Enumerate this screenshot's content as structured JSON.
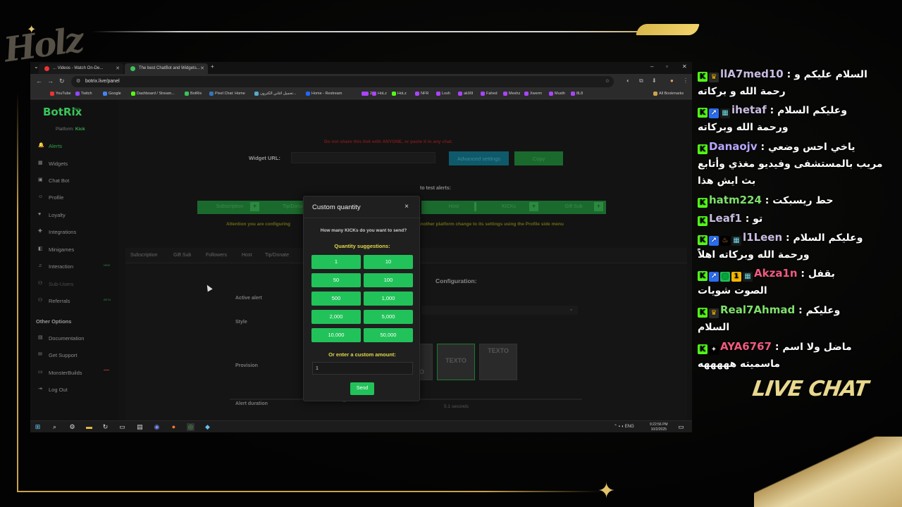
{
  "overlay": {
    "logo_text": "Holz",
    "live_chat_title": "LIVE CHAT",
    "accent_gold": "#c9a24a"
  },
  "browser": {
    "tabs": [
      {
        "label": "... Videos - Watch On-De...",
        "favicon_color": "#e33"
      },
      {
        "label": "The best ChatBot and Widgets...",
        "favicon_color": "#39c45a"
      }
    ],
    "new_tab": "+",
    "url": "botrix.live/panel",
    "bookmarks": [
      {
        "label": "YouTube",
        "color": "#e33"
      },
      {
        "label": "Twitch",
        "color": "#9146ff"
      },
      {
        "label": "Google",
        "color": "#4285f4"
      },
      {
        "label": "Dashboard / Stream...",
        "color": "#53fc18"
      },
      {
        "label": "BotRix",
        "color": "#39c45a"
      },
      {
        "label": "Pixel Chat: Home",
        "color": "#37b"
      },
      {
        "label": "تحميل اغاني الكترون...",
        "color": "#5ac"
      },
      {
        "label": "Home - Restream",
        "color": "#26f"
      },
      {
        "label": "",
        "color": "#a4f"
      },
      {
        "label": "2",
        "color": "#a4f"
      },
      {
        "label": "HoLz",
        "color": "#a4f"
      },
      {
        "label": "HoLz",
        "color": "#53fc18"
      },
      {
        "label": "NFR",
        "color": "#a4f"
      },
      {
        "label": "Losh",
        "color": "#a4f"
      },
      {
        "label": "ak90l",
        "color": "#a4f"
      },
      {
        "label": "Fahed",
        "color": "#a4f"
      },
      {
        "label": "Meshz",
        "color": "#a4f"
      },
      {
        "label": "Xwerm",
        "color": "#a4f"
      },
      {
        "label": "Musth",
        "color": "#a4f"
      },
      {
        "label": "8L8",
        "color": "#a4f"
      }
    ],
    "all_bookmarks": "All Bookmarks"
  },
  "sidebar": {
    "brand": "BotRix",
    "beta": "BETA",
    "platform_label": "Platform:",
    "platform_value": "Kick",
    "items": [
      {
        "label": "Alerts",
        "icon": "bell"
      },
      {
        "label": "Widgets",
        "icon": "grid"
      },
      {
        "label": "Chat Bot",
        "icon": "robot"
      },
      {
        "label": "Profile",
        "icon": "user"
      },
      {
        "label": "Loyalty",
        "icon": "heart"
      },
      {
        "label": "Integrations",
        "icon": "puzzle"
      },
      {
        "label": "Minigames",
        "icon": "gamepad"
      },
      {
        "label": "Interaction",
        "icon": "music"
      },
      {
        "label": "Sub-Users",
        "icon": "users"
      },
      {
        "label": "Referrals",
        "icon": "people"
      }
    ],
    "interaction_badge": "NEW",
    "referrals_badge": "BETA",
    "other_options_title": "Other Options",
    "other_items": [
      {
        "label": "Documentation",
        "icon": "doc"
      },
      {
        "label": "Get Support",
        "icon": "chat"
      },
      {
        "label": "MonsterBuilds",
        "icon": "monitor"
      },
      {
        "label": "Log Out",
        "icon": "logout"
      }
    ]
  },
  "main": {
    "share_warning": "Do not share this link with ANYONE, or paste it in any chat.",
    "widget_url_label": "Widget URL:",
    "advanced_settings": "Advanced settings",
    "copy": "Copy",
    "test_alerts": "to test alerts:",
    "test_buttons": [
      "Subscription",
      "Tip/Donate",
      "Host",
      "KICKs",
      "Gift Sub"
    ],
    "attention_left": "Attention you are configuring",
    "attention_right": "another platform change to its settings using the Profile side menu",
    "alert_tabs": [
      "Subscription",
      "Gift Sub",
      "Followers",
      "Host",
      "Tip/Donate"
    ],
    "config_title": "Configuration:",
    "active_alert": "Active alert",
    "style": "Style",
    "provision": "Provision",
    "alert_duration": "Alert duration",
    "seconds": "5.1 seconds",
    "texto": "TEXTO"
  },
  "modal": {
    "title": "Custom quantity",
    "close": "×",
    "question": "How many KICKs do you want to send?",
    "suggestions_title": "Quantity suggestions:",
    "suggestions": [
      "1",
      "10",
      "50",
      "100",
      "500",
      "1,000",
      "2,000",
      "5,000",
      "10,000",
      "50,000"
    ],
    "custom_title": "Or enter a custom amount:",
    "input_value": "1",
    "send": "Send"
  },
  "taskbar": {
    "tray_lang": "ENG",
    "time": "9:22:56 PM",
    "date": "10/2/2025"
  },
  "chat": {
    "messages": [
      {
        "user": "llA7med10",
        "user_color": "#c9bce0",
        "badges": [
          "crown"
        ],
        "text": "السلام عليكم و",
        "text2": "رحمة الله و بركاته"
      },
      {
        "user": "ihetaf",
        "user_color": "#c9bce0",
        "badges": [
          "sub-arrow",
          "og"
        ],
        "text": "وعليكم السلام",
        "text2": "ورحمة الله وبركاته"
      },
      {
        "user": "Danaojv",
        "user_color": "#b9a6ff",
        "badges": [],
        "text": "ياخي احس وضعي",
        "text2": "مريب بالمستشفى وفيديو مغذي وأتابع",
        "text3": "بث ايش هذا"
      },
      {
        "user": "hatm224",
        "user_color": "#7fe06a",
        "badges": [],
        "text": "حط ريسبكت",
        "text2": ""
      },
      {
        "user": "Leaf1",
        "user_color": "#c9bce0",
        "badges": [],
        "text": "تو",
        "text2": ""
      },
      {
        "user": "l1Leen",
        "user_color": "#c9bce0",
        "badges": [
          "sub-arrow",
          "flame",
          "og"
        ],
        "text": "وعليكم السلام",
        "text2": "ورحمة الله وبركاته اهلاً"
      },
      {
        "user": "Akza1n",
        "user_color": "#f05a7e",
        "badges": [
          "sub-arrow",
          "gift",
          "one",
          "og"
        ],
        "text": "بقفل",
        "text2": "الصوت شويات"
      },
      {
        "user": "Real7Ahmad",
        "user_color": "#7fe06a",
        "badges": [
          "crown"
        ],
        "text": "وعليكم",
        "text2": "السلام"
      },
      {
        "user": "AYA6767",
        "user_color": "#f05a7e",
        "badges": [
          "sparkle"
        ],
        "text": "ماضل ولا اسم",
        "text2": "ماسميته هههههه"
      }
    ],
    "kick_color": "#53fc18"
  }
}
